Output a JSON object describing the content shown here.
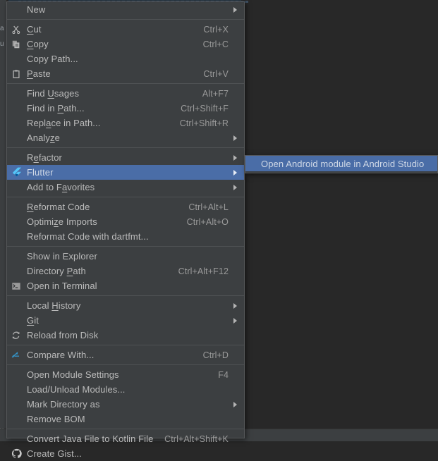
{
  "window": {
    "app": "Android Studio",
    "theme_bg": "#3c3f41",
    "backdrop_bg": "#282828",
    "highlight_color": "#4a6da7",
    "text_color": "#bbbbbb",
    "shortcut_color": "#9a9a9a",
    "separator_color": "#4f5254",
    "edge_chars": [
      "a",
      "u",
      "x"
    ]
  },
  "context_menu": {
    "name": "project-view-context-menu",
    "groups": [
      {
        "items": [
          {
            "label": "New",
            "mnemonic": "",
            "icon": "none",
            "shortcut": "",
            "submenu": true,
            "selected": false
          }
        ]
      },
      {
        "items": [
          {
            "label": "Cut",
            "mnemonic": "C",
            "icon": "scissors-icon",
            "shortcut": "Ctrl+X",
            "submenu": false,
            "selected": false
          },
          {
            "label": "Copy",
            "mnemonic": "C",
            "icon": "copy-icon",
            "shortcut": "Ctrl+C",
            "submenu": false,
            "selected": false
          },
          {
            "label": "Copy Path...",
            "mnemonic": "",
            "icon": "none",
            "shortcut": "",
            "submenu": false,
            "selected": false
          },
          {
            "label": "Paste",
            "mnemonic": "P",
            "icon": "clipboard-icon",
            "shortcut": "Ctrl+V",
            "submenu": false,
            "selected": false
          }
        ]
      },
      {
        "items": [
          {
            "label": "Find Usages",
            "mnemonic": "U",
            "icon": "none",
            "shortcut": "Alt+F7",
            "submenu": false,
            "selected": false
          },
          {
            "label": "Find in Path...",
            "mnemonic": "P",
            "icon": "none",
            "shortcut": "Ctrl+Shift+F",
            "submenu": false,
            "selected": false
          },
          {
            "label": "Replace in Path...",
            "mnemonic": "a",
            "icon": "none",
            "shortcut": "Ctrl+Shift+R",
            "submenu": false,
            "selected": false
          },
          {
            "label": "Analyze",
            "mnemonic": "z",
            "icon": "none",
            "shortcut": "",
            "submenu": true,
            "selected": false
          }
        ]
      },
      {
        "items": [
          {
            "label": "Refactor",
            "mnemonic": "e",
            "icon": "none",
            "shortcut": "",
            "submenu": true,
            "selected": false
          },
          {
            "label": "Flutter",
            "mnemonic": "",
            "icon": "flutter-icon",
            "shortcut": "",
            "submenu": true,
            "selected": true
          },
          {
            "label": "Add to Favorites",
            "mnemonic": "a",
            "icon": "none",
            "shortcut": "",
            "submenu": true,
            "selected": false
          }
        ]
      },
      {
        "items": [
          {
            "label": "Reformat Code",
            "mnemonic": "R",
            "icon": "none",
            "shortcut": "Ctrl+Alt+L",
            "submenu": false,
            "selected": false
          },
          {
            "label": "Optimize Imports",
            "mnemonic": "z",
            "icon": "none",
            "shortcut": "Ctrl+Alt+O",
            "submenu": false,
            "selected": false
          },
          {
            "label": "Reformat Code with dartfmt...",
            "mnemonic": "",
            "icon": "none",
            "shortcut": "",
            "submenu": false,
            "selected": false
          }
        ]
      },
      {
        "items": [
          {
            "label": "Show in Explorer",
            "mnemonic": "",
            "icon": "none",
            "shortcut": "",
            "submenu": false,
            "selected": false
          },
          {
            "label": "Directory Path",
            "mnemonic": "P",
            "icon": "none",
            "shortcut": "Ctrl+Alt+F12",
            "submenu": false,
            "selected": false
          },
          {
            "label": "Open in Terminal",
            "mnemonic": "",
            "icon": "terminal-icon",
            "shortcut": "",
            "submenu": false,
            "selected": false
          }
        ]
      },
      {
        "items": [
          {
            "label": "Local History",
            "mnemonic": "H",
            "icon": "none",
            "shortcut": "",
            "submenu": true,
            "selected": false
          },
          {
            "label": "Git",
            "mnemonic": "G",
            "icon": "none",
            "shortcut": "",
            "submenu": true,
            "selected": false
          },
          {
            "label": "Reload from Disk",
            "mnemonic": "",
            "icon": "reload-icon",
            "shortcut": "",
            "submenu": false,
            "selected": false
          }
        ]
      },
      {
        "items": [
          {
            "label": "Compare With...",
            "mnemonic": "",
            "icon": "compare-icon",
            "shortcut": "Ctrl+D",
            "submenu": false,
            "selected": false
          }
        ]
      },
      {
        "items": [
          {
            "label": "Open Module Settings",
            "mnemonic": "",
            "icon": "none",
            "shortcut": "F4",
            "submenu": false,
            "selected": false
          },
          {
            "label": "Load/Unload Modules...",
            "mnemonic": "",
            "icon": "none",
            "shortcut": "",
            "submenu": false,
            "selected": false
          },
          {
            "label": "Mark Directory as",
            "mnemonic": "",
            "icon": "none",
            "shortcut": "",
            "submenu": true,
            "selected": false
          },
          {
            "label": "Remove BOM",
            "mnemonic": "",
            "icon": "none",
            "shortcut": "",
            "submenu": false,
            "selected": false
          }
        ]
      },
      {
        "items": [
          {
            "label": "Convert Java File to Kotlin File",
            "mnemonic": "",
            "icon": "none",
            "shortcut": "Ctrl+Alt+Shift+K",
            "submenu": false,
            "selected": false
          },
          {
            "label": "Create Gist...",
            "mnemonic": "",
            "icon": "github-icon",
            "shortcut": "",
            "submenu": false,
            "selected": false
          }
        ]
      }
    ]
  },
  "submenu": {
    "name": "flutter-submenu",
    "items": [
      {
        "label": "Open Android module in Android Studio",
        "selected": true
      }
    ]
  }
}
